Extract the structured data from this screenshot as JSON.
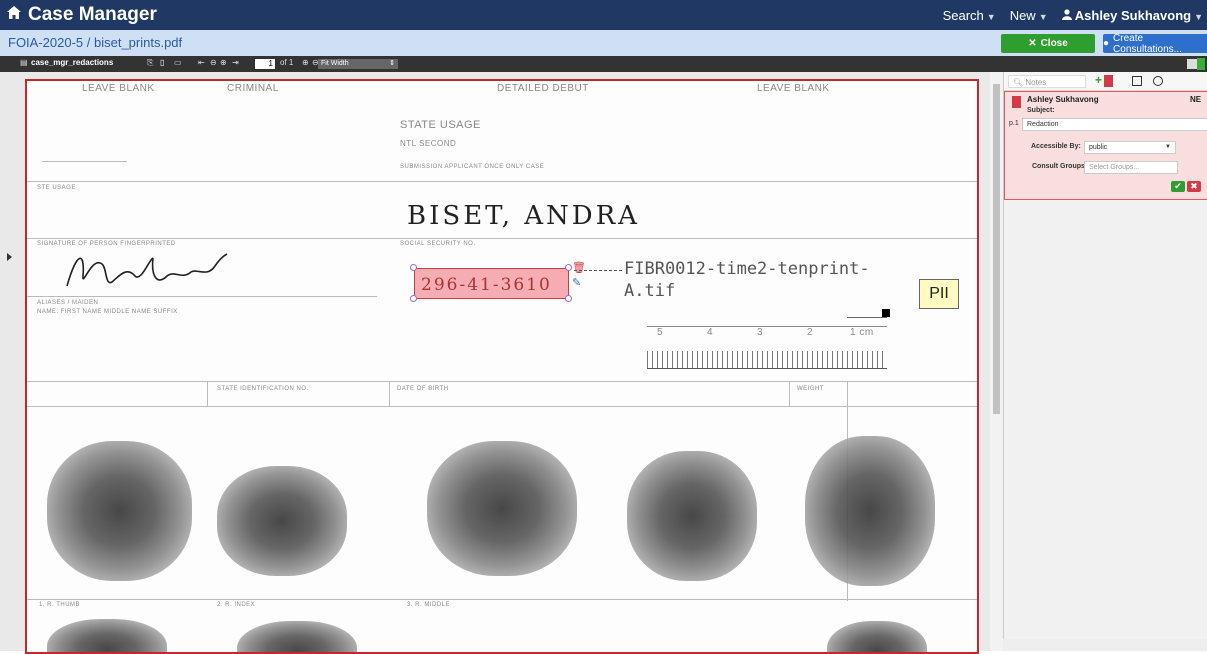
{
  "app": {
    "title": "Case Manager"
  },
  "topnav": {
    "search": "Search",
    "new": "New",
    "user": "Ashley Sukhavong"
  },
  "subbar": {
    "breadcrumb": "FOIA-2020-5 / biset_prints.pdf",
    "close_label": "Close",
    "consult_label": "Create Consultations..."
  },
  "toolbar": {
    "layer": "case_mgr_redactions",
    "page_current": "1",
    "page_of": "of 1",
    "zoom": "Fit Width"
  },
  "document": {
    "header_texts": [
      "LEAVE BLANK",
      "CRIMINAL",
      "DETAILED DEBUT",
      "LEAVE BLANK"
    ],
    "field_labels": {
      "state_usage": "STATE USAGE",
      "ntl_second": "NTL SECOND",
      "submission": "SUBMISSION  APPLICANT  ONCE  ONLY  CASE",
      "sig_label": "SIGNATURE OF PERSON FINGERPRINTED",
      "ssn_label": "SOCIAL SECURITY NO.",
      "alias_label": "ALIASES / MAIDEN",
      "name_label": "NAME: FIRST NAME  MIDDLE NAME  SUFFIX",
      "state_id": "STATE IDENTIFICATION NO.",
      "dob_label": "DATE OF BIRTH",
      "weight_label": "WEIGHT",
      "right_thumb": "1. R. THUMB",
      "right_index": "2. R. INDEX",
      "right_middle": "3. R. MIDDLE"
    },
    "handwritten_name": "BISET, ANDRA",
    "ssn_redacted": "296-41-3610",
    "file_ref_line1": "FIBR0012-time2-tenprint-",
    "file_ref_line2": "A.tif",
    "pii_label": "PII",
    "ruler_marks": [
      "5",
      "4",
      "3",
      "2",
      "1 cm"
    ]
  },
  "panel": {
    "notes_placeholder": "Notes",
    "author": "Ashley Sukhavong",
    "badge": "NE",
    "subject_label": "Subject:",
    "page_ref": "p.1",
    "subject_value": "Redaction",
    "accessible_label": "Accessible By:",
    "accessible_value": "public",
    "consult_label": "Consult Groups:",
    "consult_placeholder": "Select Groups..."
  }
}
